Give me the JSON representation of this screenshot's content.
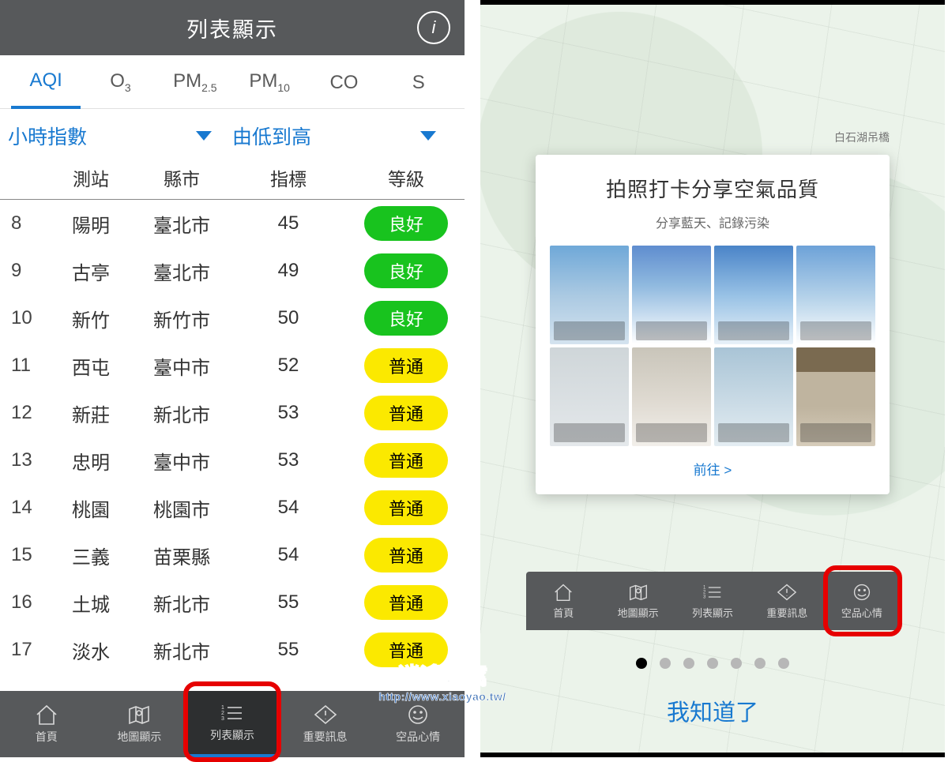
{
  "left": {
    "header_title": "列表顯示",
    "info_label": "i",
    "tabs": [
      "AQI",
      "O3",
      "PM2.5",
      "PM10",
      "CO",
      "S"
    ],
    "filter_time": "小時指數",
    "filter_sort": "由低到高",
    "col_station": "測站",
    "col_city": "縣市",
    "col_index": "指標",
    "col_grade": "等級",
    "rows": [
      {
        "rank": "8",
        "station": "陽明",
        "city": "臺北市",
        "index": "45",
        "grade": "良好",
        "cls": "good"
      },
      {
        "rank": "9",
        "station": "古亭",
        "city": "臺北市",
        "index": "49",
        "grade": "良好",
        "cls": "good"
      },
      {
        "rank": "10",
        "station": "新竹",
        "city": "新竹市",
        "index": "50",
        "grade": "良好",
        "cls": "good"
      },
      {
        "rank": "11",
        "station": "西屯",
        "city": "臺中市",
        "index": "52",
        "grade": "普通",
        "cls": "moderate"
      },
      {
        "rank": "12",
        "station": "新莊",
        "city": "新北市",
        "index": "53",
        "grade": "普通",
        "cls": "moderate"
      },
      {
        "rank": "13",
        "station": "忠明",
        "city": "臺中市",
        "index": "53",
        "grade": "普通",
        "cls": "moderate"
      },
      {
        "rank": "14",
        "station": "桃園",
        "city": "桃園市",
        "index": "54",
        "grade": "普通",
        "cls": "moderate"
      },
      {
        "rank": "15",
        "station": "三義",
        "city": "苗栗縣",
        "index": "54",
        "grade": "普通",
        "cls": "moderate"
      },
      {
        "rank": "16",
        "station": "土城",
        "city": "新北市",
        "index": "55",
        "grade": "普通",
        "cls": "moderate"
      },
      {
        "rank": "17",
        "station": "淡水",
        "city": "新北市",
        "index": "55",
        "grade": "普通",
        "cls": "moderate"
      }
    ],
    "nav": [
      "首頁",
      "地圖顯示",
      "列表顯示",
      "重要訊息",
      "空品心情"
    ]
  },
  "right": {
    "map_poi": "白石湖吊橋",
    "card_title": "拍照打卡分享空氣品質",
    "card_sub": "分享藍天、記錄污染",
    "go": "前往 >",
    "nav": [
      "首頁",
      "地圖顯示",
      "列表顯示",
      "重要訊息",
      "空品心情"
    ],
    "know": "我知道了",
    "dots": 7,
    "active_dot": 0
  },
  "watermark": {
    "line1": "逍遙の窩",
    "line2": "http://www.xiaoyao.tw/"
  }
}
